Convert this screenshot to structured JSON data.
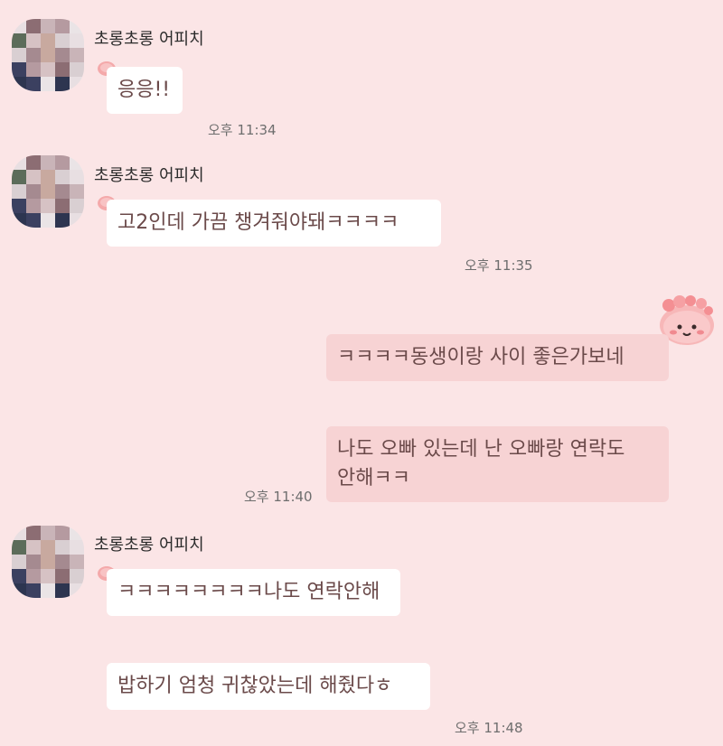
{
  "messages": [
    {
      "sender": "초롱초롱 어피치",
      "text": "응응!!",
      "time": "오후 11:34"
    },
    {
      "sender": "초롱초롱 어피치",
      "text": "고2인데 가끔 챙겨줘야돼ㅋㅋㅋㅋ",
      "time": "오후 11:35"
    },
    {
      "sender": "me",
      "text": "ㅋㅋㅋㅋ동생이랑 사이 좋은가보네"
    },
    {
      "sender": "me",
      "text_line1": "나도 오빠 있는데 난 오빠랑 연락도",
      "text_line2": "안해ㅋㅋ",
      "time": "오후 11:40"
    },
    {
      "sender": "초롱초롱 어피치",
      "text": "ㅋㅋㅋㅋㅋㅋㅋㅋ나도 연락안해"
    },
    {
      "sender": "초롱초롱 어피치",
      "text": "밥하기 엄청 귀찮았는데 해줬다ㅎ",
      "time": "오후 11:48"
    }
  ],
  "colors": {
    "background": "#fbe5e6",
    "bubble_received": "#ffffff",
    "bubble_sent": "#f7d3d4",
    "text": "#6b4a4a"
  },
  "icons": {
    "avatar": "pixelated-profile-avatar",
    "bubble_tail": "peach-icon",
    "sticker": "apeach-flower-sticker"
  }
}
